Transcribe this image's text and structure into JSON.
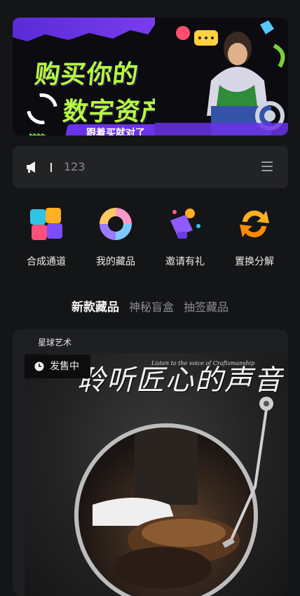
{
  "banner": {
    "line1": "购买你的",
    "line2": "数字资产",
    "cta": "跟着买就对了"
  },
  "notice": {
    "text": "123"
  },
  "entries": [
    {
      "label": "合成通道",
      "icon": "puzzle-icon"
    },
    {
      "label": "我的藏品",
      "icon": "collection-ring-icon"
    },
    {
      "label": "邀请有礼",
      "icon": "gift-megaphone-icon"
    },
    {
      "label": "置换分解",
      "icon": "swap-arrows-icon"
    }
  ],
  "tabs": [
    {
      "label": "新款藏品",
      "active": true
    },
    {
      "label": "神秘盲盒",
      "active": false
    },
    {
      "label": "抽签藏品",
      "active": false
    }
  ],
  "card": {
    "publisher": "星球艺术",
    "status": "发售中",
    "title_art": "聆听匠心的声音",
    "tagline": "Listen to the voice of Craftsmanship"
  },
  "colors": {
    "background": "#141517",
    "accent_green": "#b6ff3b",
    "accent_purple": "#6b33e6"
  }
}
